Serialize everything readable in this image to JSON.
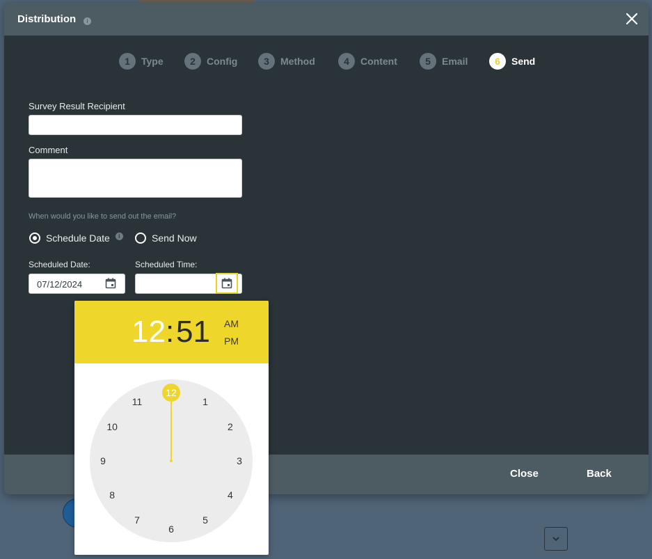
{
  "window": {
    "title": "Distribution"
  },
  "stepper": {
    "steps": [
      {
        "num": "1",
        "label": "Type"
      },
      {
        "num": "2",
        "label": "Config"
      },
      {
        "num": "3",
        "label": "Method"
      },
      {
        "num": "4",
        "label": "Content"
      },
      {
        "num": "5",
        "label": "Email"
      },
      {
        "num": "6",
        "label": "Send"
      }
    ],
    "active_index": 5
  },
  "form": {
    "recipient_label": "Survey Result Recipient",
    "recipient_value": "",
    "comment_label": "Comment",
    "comment_value": "",
    "send_question": "When would you like to send out the email?",
    "option_schedule": "Schedule Date",
    "option_now": "Send Now",
    "selected_option": "Schedule Date",
    "scheduled_date_label": "Scheduled Date:",
    "scheduled_date_value": "07/12/2024",
    "scheduled_time_label": "Scheduled Time:",
    "scheduled_time_value": ""
  },
  "time_picker": {
    "hour": "12",
    "colon": ":",
    "minute": "51",
    "am_label": "AM",
    "pm_label": "PM",
    "selected_hour": "12",
    "dial_numbers": [
      "12",
      "1",
      "2",
      "3",
      "4",
      "5",
      "6",
      "7",
      "8",
      "9",
      "10",
      "11"
    ],
    "accent_color": "#eed62a"
  },
  "footer": {
    "close_label": "Close",
    "back_label": "Back"
  },
  "icons": {
    "info": "i",
    "close": "close-icon",
    "calendar": "calendar-icon",
    "chevron": "chevron-down-icon"
  }
}
